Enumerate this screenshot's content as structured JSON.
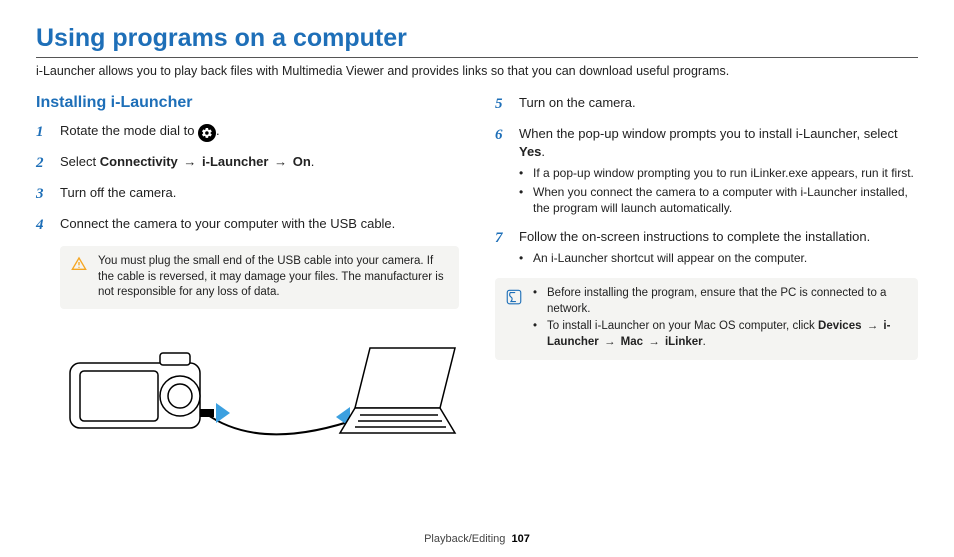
{
  "title": "Using programs on a computer",
  "intro": "i-Launcher allows you to play back files with Multimedia Viewer and provides links so that you can download useful programs.",
  "section_left_title": "Installing i-Launcher",
  "steps": {
    "s1_pre": "Rotate the mode dial to ",
    "s1_post": ".",
    "s2_pre": "Select ",
    "s2_b1": "Connectivity",
    "s2_b2": "i-Launcher",
    "s2_b3": "On",
    "s2_post": ".",
    "s3": "Turn off the camera.",
    "s4": "Connect the camera to your computer with the USB cable.",
    "s5": "Turn on the camera.",
    "s6_main": "When the pop-up window prompts you to install i-Launcher, select ",
    "s6_bold": "Yes",
    "s6_post": ".",
    "s6_sub1": "If a pop-up window prompting you to run iLinker.exe appears, run it first.",
    "s6_sub2": "When you connect the camera to a computer with i-Launcher installed, the program will launch automatically.",
    "s7_main": "Follow the on-screen instructions to complete the installation.",
    "s7_sub1": "An i-Launcher shortcut will appear on the computer."
  },
  "warn_note": "You must plug the small end of the USB cable into your camera. If the cable is reversed, it may damage your files. The manufacturer is not responsible for any loss of data.",
  "info_note": {
    "b1": "Before installing the program, ensure that the PC is connected to a network.",
    "b2_pre": "To install i-Launcher on your Mac OS computer, click ",
    "b2_dev": "Devices",
    "b2_il": "i-Launcher",
    "b2_mac": "Mac",
    "b2_ilk": "iLinker",
    "b2_post": "."
  },
  "arrow": "→",
  "footer_section": "Playback/Editing",
  "footer_page": "107"
}
